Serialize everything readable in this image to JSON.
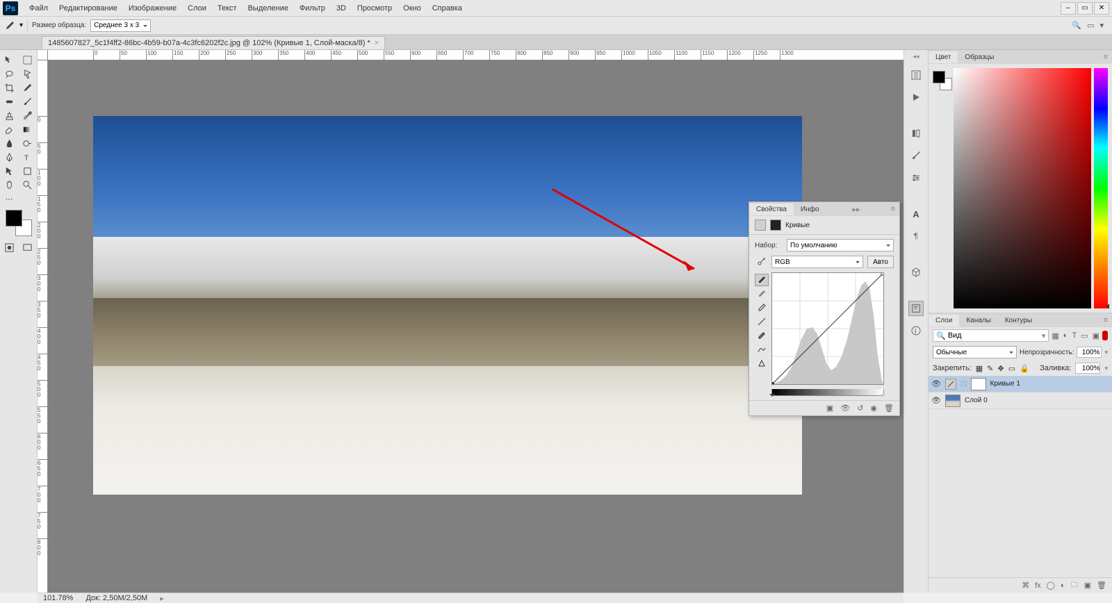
{
  "menu": {
    "items": [
      "Файл",
      "Редактирование",
      "Изображение",
      "Слои",
      "Текст",
      "Выделение",
      "Фильтр",
      "3D",
      "Просмотр",
      "Окно",
      "Справка"
    ]
  },
  "optionbar": {
    "sample_label": "Размер образца:",
    "sample_value": "Среднее 3 x 3"
  },
  "document": {
    "tab_title": "1485607827_5c1f4ff2-86bc-4b59-b07a-4c3fc6202f2c.jpg @ 102% (Кривые 1, Слой-маска/8) *"
  },
  "ruler_h": [
    0,
    50,
    100,
    150,
    200,
    250,
    300,
    350,
    400,
    450,
    500,
    550,
    600,
    650,
    700,
    750,
    800,
    850,
    900,
    950,
    1000,
    1050,
    1100,
    1150,
    1200,
    1250,
    1300
  ],
  "ruler_v": [
    0,
    50,
    100,
    150,
    200,
    250,
    300,
    350,
    400,
    450,
    500,
    550,
    600,
    650,
    700,
    750,
    800
  ],
  "status": {
    "zoom": "101.78%",
    "doc_size": "Док: 2,50M/2,50M"
  },
  "panels": {
    "color_tabs": [
      "Цвет",
      "Образцы"
    ],
    "layers_tabs": [
      "Слои",
      "Каналы",
      "Контуры"
    ],
    "layer_search_placeholder": "Вид",
    "blend_mode": "Обычные",
    "opacity_label": "Непрозрачность:",
    "opacity_value": "100%",
    "lock_label": "Закрепить:",
    "fill_label": "Заливка:",
    "fill_value": "100%",
    "layers": [
      {
        "name": "Кривые 1",
        "selected": true,
        "has_mask": true
      },
      {
        "name": "Слой 0",
        "selected": false,
        "has_mask": false
      }
    ]
  },
  "properties": {
    "tabs": [
      "Свойства",
      "Инфо"
    ],
    "title": "Кривые",
    "preset_label": "Набор:",
    "preset_value": "По умолчанию",
    "channel_value": "RGB",
    "auto_label": "Авто"
  }
}
